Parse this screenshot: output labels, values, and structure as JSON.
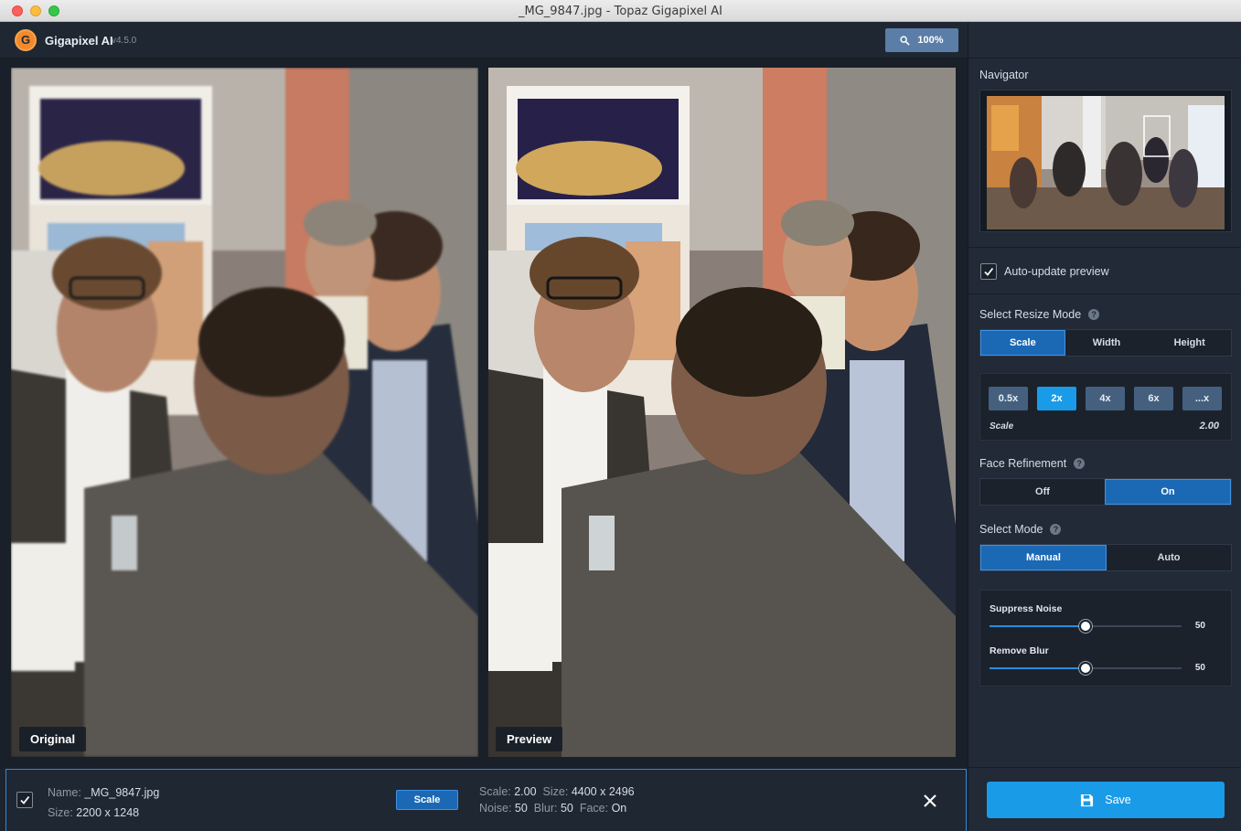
{
  "window": {
    "title": "_MG_9847.jpg - Topaz Gigapixel AI"
  },
  "app": {
    "logo_letter": "G",
    "name": "Gigapixel AI",
    "version": "v4.5.0",
    "zoom_label": "100%"
  },
  "viewer": {
    "original_label": "Original",
    "preview_label": "Preview"
  },
  "panel": {
    "navigator_title": "Navigator",
    "auto_update_label": "Auto-update preview",
    "auto_update_checked": true,
    "resize_mode_title": "Select Resize Mode",
    "resize_modes": [
      "Scale",
      "Width",
      "Height"
    ],
    "resize_mode_active": "Scale",
    "scale_options": [
      "0.5x",
      "2x",
      "4x",
      "6x",
      "...x"
    ],
    "scale_active": "2x",
    "scale_label": "Scale",
    "scale_value": "2.00",
    "face_refinement_title": "Face Refinement",
    "face_options": [
      "Off",
      "On"
    ],
    "face_active": "On",
    "select_mode_title": "Select Mode",
    "mode_options": [
      "Manual",
      "Auto"
    ],
    "mode_active": "Manual",
    "suppress_noise_label": "Suppress Noise",
    "suppress_noise_value": 50,
    "remove_blur_label": "Remove Blur",
    "remove_blur_value": 50,
    "slider_max": 100,
    "save_label": "Save"
  },
  "filebar": {
    "name_key": "Name:",
    "name_value": "_MG_9847.jpg",
    "size_key": "Size:",
    "size_value": "2200 x 1248",
    "mode_badge": "Scale",
    "scale_key": "Scale:",
    "scale_value": "2.00",
    "out_size_key": "Size:",
    "out_size_value": "4400 x 2496",
    "noise_key": "Noise:",
    "noise_value": "50",
    "blur_key": "Blur:",
    "blur_value": "50",
    "face_key": "Face:",
    "face_value": "On"
  },
  "colors": {
    "accent": "#1a9be8",
    "active_segment": "#1b69b5",
    "panel_bg": "#212a36",
    "viewer_bg": "#1a2029"
  }
}
